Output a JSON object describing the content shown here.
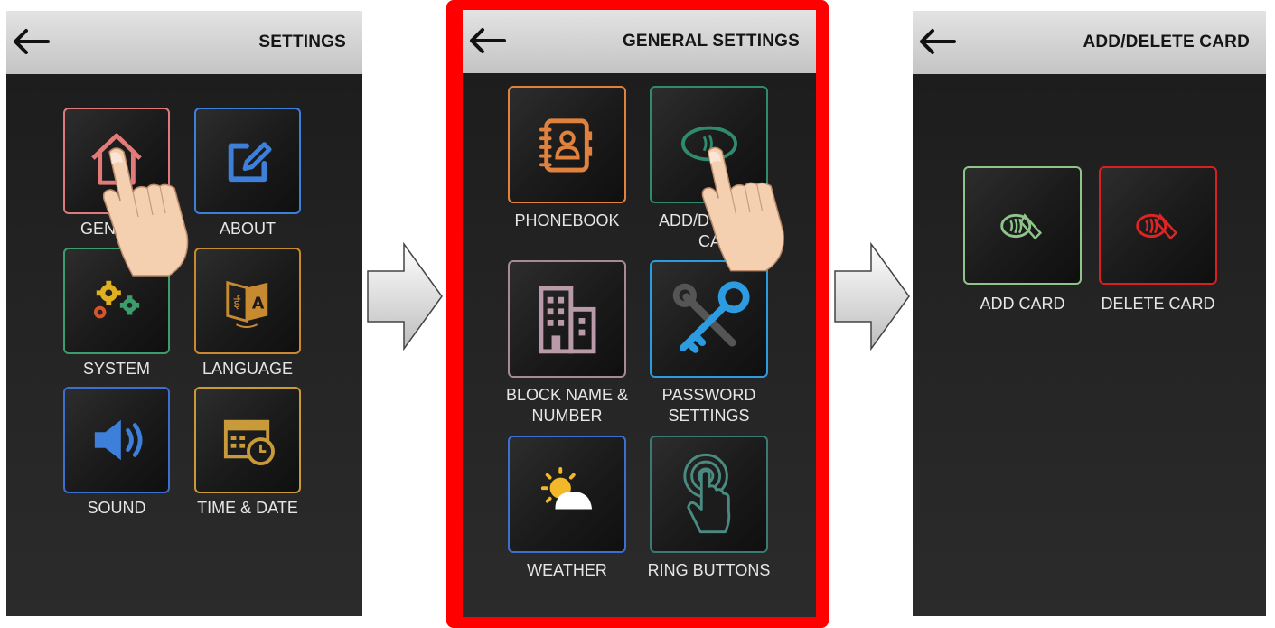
{
  "screen_settings": {
    "title": "SETTINGS",
    "tiles": [
      "GENERAL",
      "ABOUT",
      "SYSTEM",
      "LANGUAGE",
      "SOUND",
      "TIME & DATE"
    ],
    "icons": [
      "home-icon",
      "edit-icon",
      "gears-icon",
      "translate-icon",
      "speaker-icon",
      "calendar-clock-icon"
    ],
    "colors": [
      "#e07a7a",
      "#3d7fd9",
      "#3c9c6c",
      "#c88a30",
      "#3d6fd0",
      "#c89a3a"
    ]
  },
  "screen_general": {
    "title": "GENERAL SETTINGS",
    "tiles": [
      "PHONEBOOK",
      "ADD/DELETE CARD",
      "BLOCK NAME & NUMBER",
      "PASSWORD SETTINGS",
      "WEATHER",
      "RING BUTTONS"
    ],
    "visible_labels": [
      "PHONEBOOK",
      "ADD/D",
      "CARD",
      "BLOCK NAME &",
      "NUMBER",
      "PASSWORD",
      "SETTINGS",
      "WEATHER",
      "RING BUTTONS"
    ],
    "icons": [
      "phonebook-icon",
      "card-tap-icon",
      "building-icon",
      "key-wrench-icon",
      "weather-icon",
      "touch-icon"
    ],
    "colors": [
      "#e0823e",
      "#2f8a6e",
      "#a88a96",
      "#2c9be0",
      "#3d6fd0",
      "#3a7a72"
    ]
  },
  "screen_card": {
    "title": "ADD/DELETE CARD",
    "tiles": [
      "ADD CARD",
      "DELETE CARD"
    ],
    "icons": [
      "card-tap-icon",
      "card-tap-icon"
    ],
    "colors": [
      "#8fc48a",
      "#d92020"
    ]
  },
  "partial_labels": {
    "general_visible": "GEN"
  },
  "highlight_color": "#ff0000"
}
